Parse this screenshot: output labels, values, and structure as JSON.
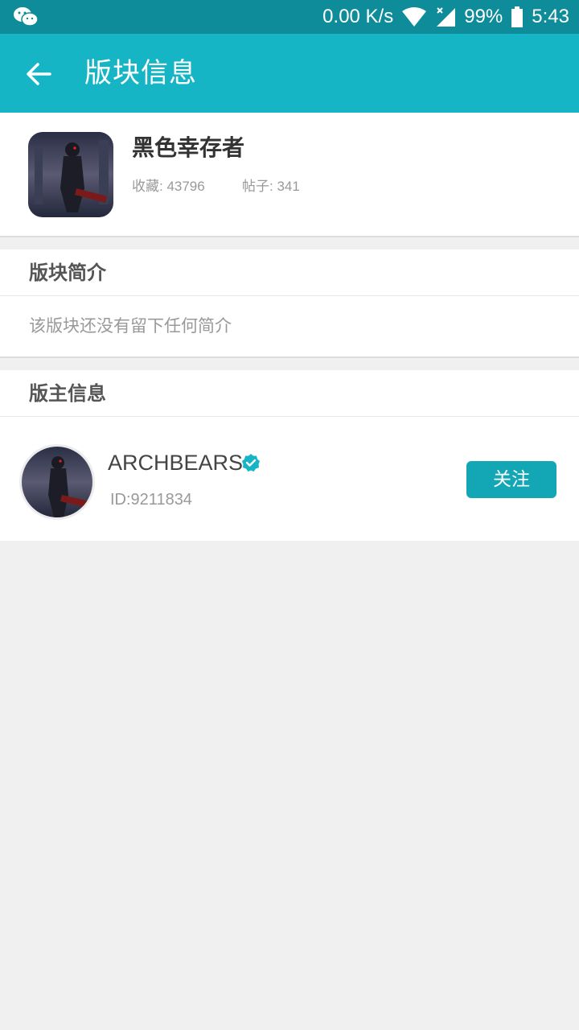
{
  "status_bar": {
    "app_icon": "wechat-icon",
    "net_speed": "0.00 K/s",
    "battery": "99%",
    "time": "5:43",
    "icons": [
      "wifi-icon",
      "signal-icon",
      "battery-icon"
    ]
  },
  "app_bar": {
    "back_icon": "arrow-left-icon",
    "title": "版块信息"
  },
  "forum": {
    "name": "黑色幸存者",
    "favorites": "收藏: 43796",
    "posts": "帖子: 341"
  },
  "intro": {
    "heading": "版块简介",
    "text": "该版块还没有留下任何简介"
  },
  "moderator": {
    "heading": "版主信息",
    "name": "ARCHBEARS",
    "id": "ID:9211834",
    "follow_label": "关注",
    "verified_icon": "verified-badge-icon"
  },
  "colors": {
    "status_bar": "#0f8c99",
    "app_bar": "#16b5c5",
    "accent_button": "#13a7b6",
    "background": "#f0f0f0"
  }
}
